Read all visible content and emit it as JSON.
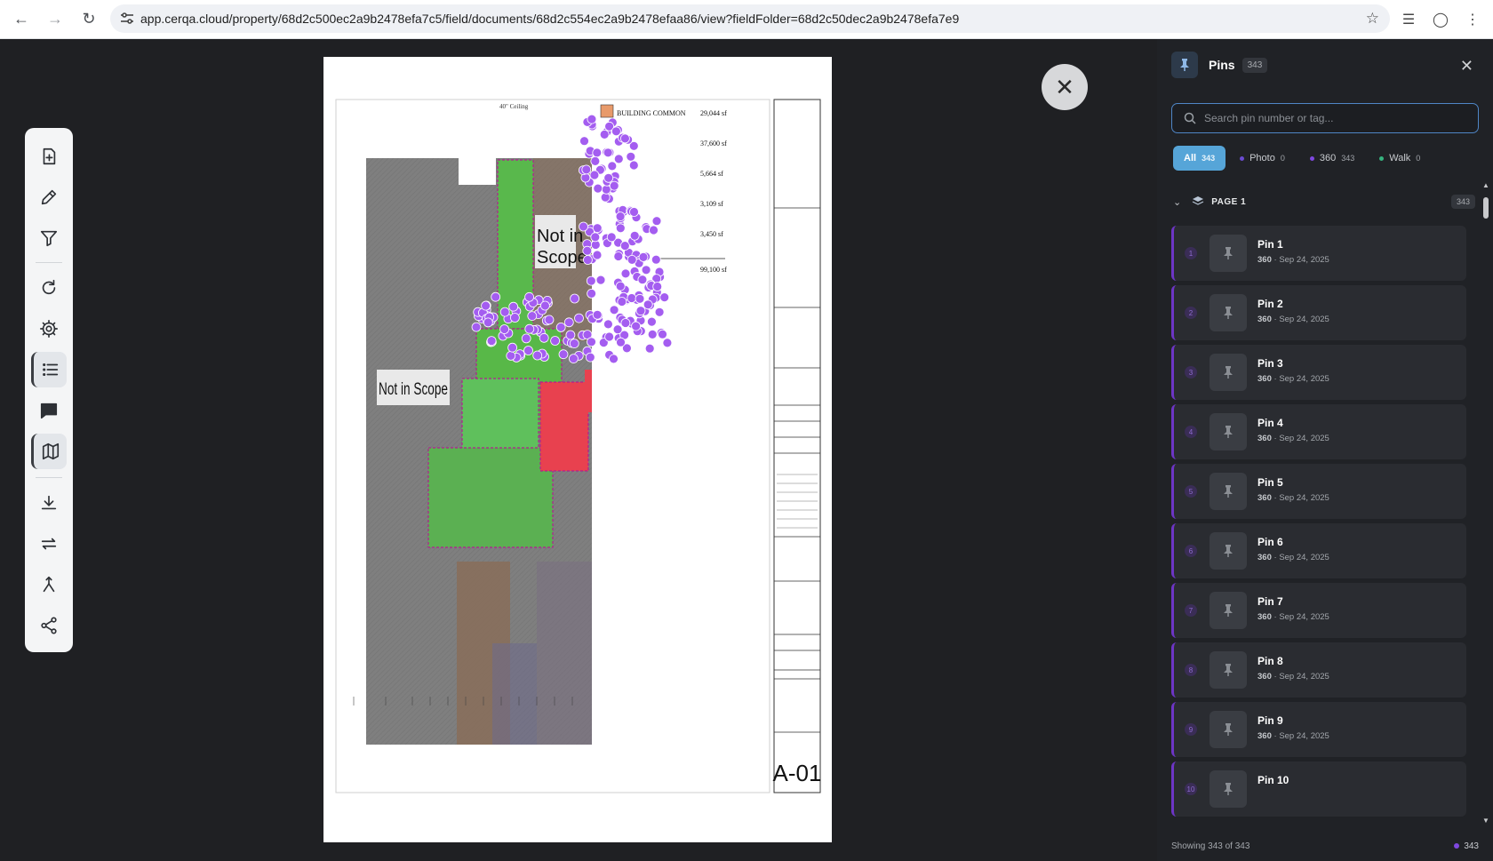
{
  "browser": {
    "url": "app.cerqa.cloud/property/68d2c500ec2a9b2478efa7c5/field/documents/68d2c554ec2a9b2478efaa86/view?fieldFolder=68d2c50dec2a9b2478efa7e9",
    "back_icon": "arrow-left-icon",
    "forward_icon": "arrow-right-icon",
    "reload_icon": "reload-icon",
    "bookmark_icon": "star-icon"
  },
  "toolbar": {
    "items": [
      {
        "name": "add-document-icon"
      },
      {
        "name": "pencil-icon"
      },
      {
        "name": "filter-icon"
      },
      {
        "name": "refresh-icon"
      },
      {
        "name": "gear-icon"
      },
      {
        "name": "list-icon"
      },
      {
        "name": "comment-icon"
      },
      {
        "name": "map-icon"
      },
      {
        "name": "download-icon"
      },
      {
        "name": "swap-icon"
      },
      {
        "name": "merge-icon"
      },
      {
        "name": "share-icon"
      }
    ]
  },
  "document": {
    "labels": {
      "building_common": "BUILDING COMMON",
      "not_in_scope_1": "Not in",
      "not_in_scope_1b": "Scope",
      "not_in_scope_2": "Not in Scope",
      "ceiling": "40\" Ceiling",
      "area_1": "29,044 sf",
      "area_2": "37,600 sf",
      "area_3": "5,664 sf",
      "area_4": "3,109 sf",
      "area_5": "3,450 sf",
      "area_6": "99,100 sf",
      "sheet": "A-01"
    }
  },
  "pins_panel": {
    "title": "Pins",
    "count": "343",
    "search_placeholder": "Search pin number or tag...",
    "filters": [
      {
        "label": "All",
        "count": "343",
        "active": true,
        "color": ""
      },
      {
        "label": "Photo",
        "count": "0",
        "active": false,
        "color": "#6a4bd1"
      },
      {
        "label": "360",
        "count": "343",
        "active": false,
        "color": "#7f48e0"
      },
      {
        "label": "Walk",
        "count": "0",
        "active": false,
        "color": "#36b37e"
      }
    ],
    "group": {
      "label": "PAGE 1",
      "count": "343"
    },
    "pins": [
      {
        "num": "1",
        "name": "Pin 1",
        "type": "360",
        "date": "Sep 24, 2025"
      },
      {
        "num": "2",
        "name": "Pin 2",
        "type": "360",
        "date": "Sep 24, 2025"
      },
      {
        "num": "3",
        "name": "Pin 3",
        "type": "360",
        "date": "Sep 24, 2025"
      },
      {
        "num": "4",
        "name": "Pin 4",
        "type": "360",
        "date": "Sep 24, 2025"
      },
      {
        "num": "5",
        "name": "Pin 5",
        "type": "360",
        "date": "Sep 24, 2025"
      },
      {
        "num": "6",
        "name": "Pin 6",
        "type": "360",
        "date": "Sep 24, 2025"
      },
      {
        "num": "7",
        "name": "Pin 7",
        "type": "360",
        "date": "Sep 24, 2025"
      },
      {
        "num": "8",
        "name": "Pin 8",
        "type": "360",
        "date": "Sep 24, 2025"
      },
      {
        "num": "9",
        "name": "Pin 9",
        "type": "360",
        "date": "Sep 24, 2025"
      },
      {
        "num": "10",
        "name": "Pin 10",
        "type": "",
        "date": ""
      }
    ],
    "footer": {
      "showing": "Showing 343 of 343",
      "total": "343"
    }
  }
}
